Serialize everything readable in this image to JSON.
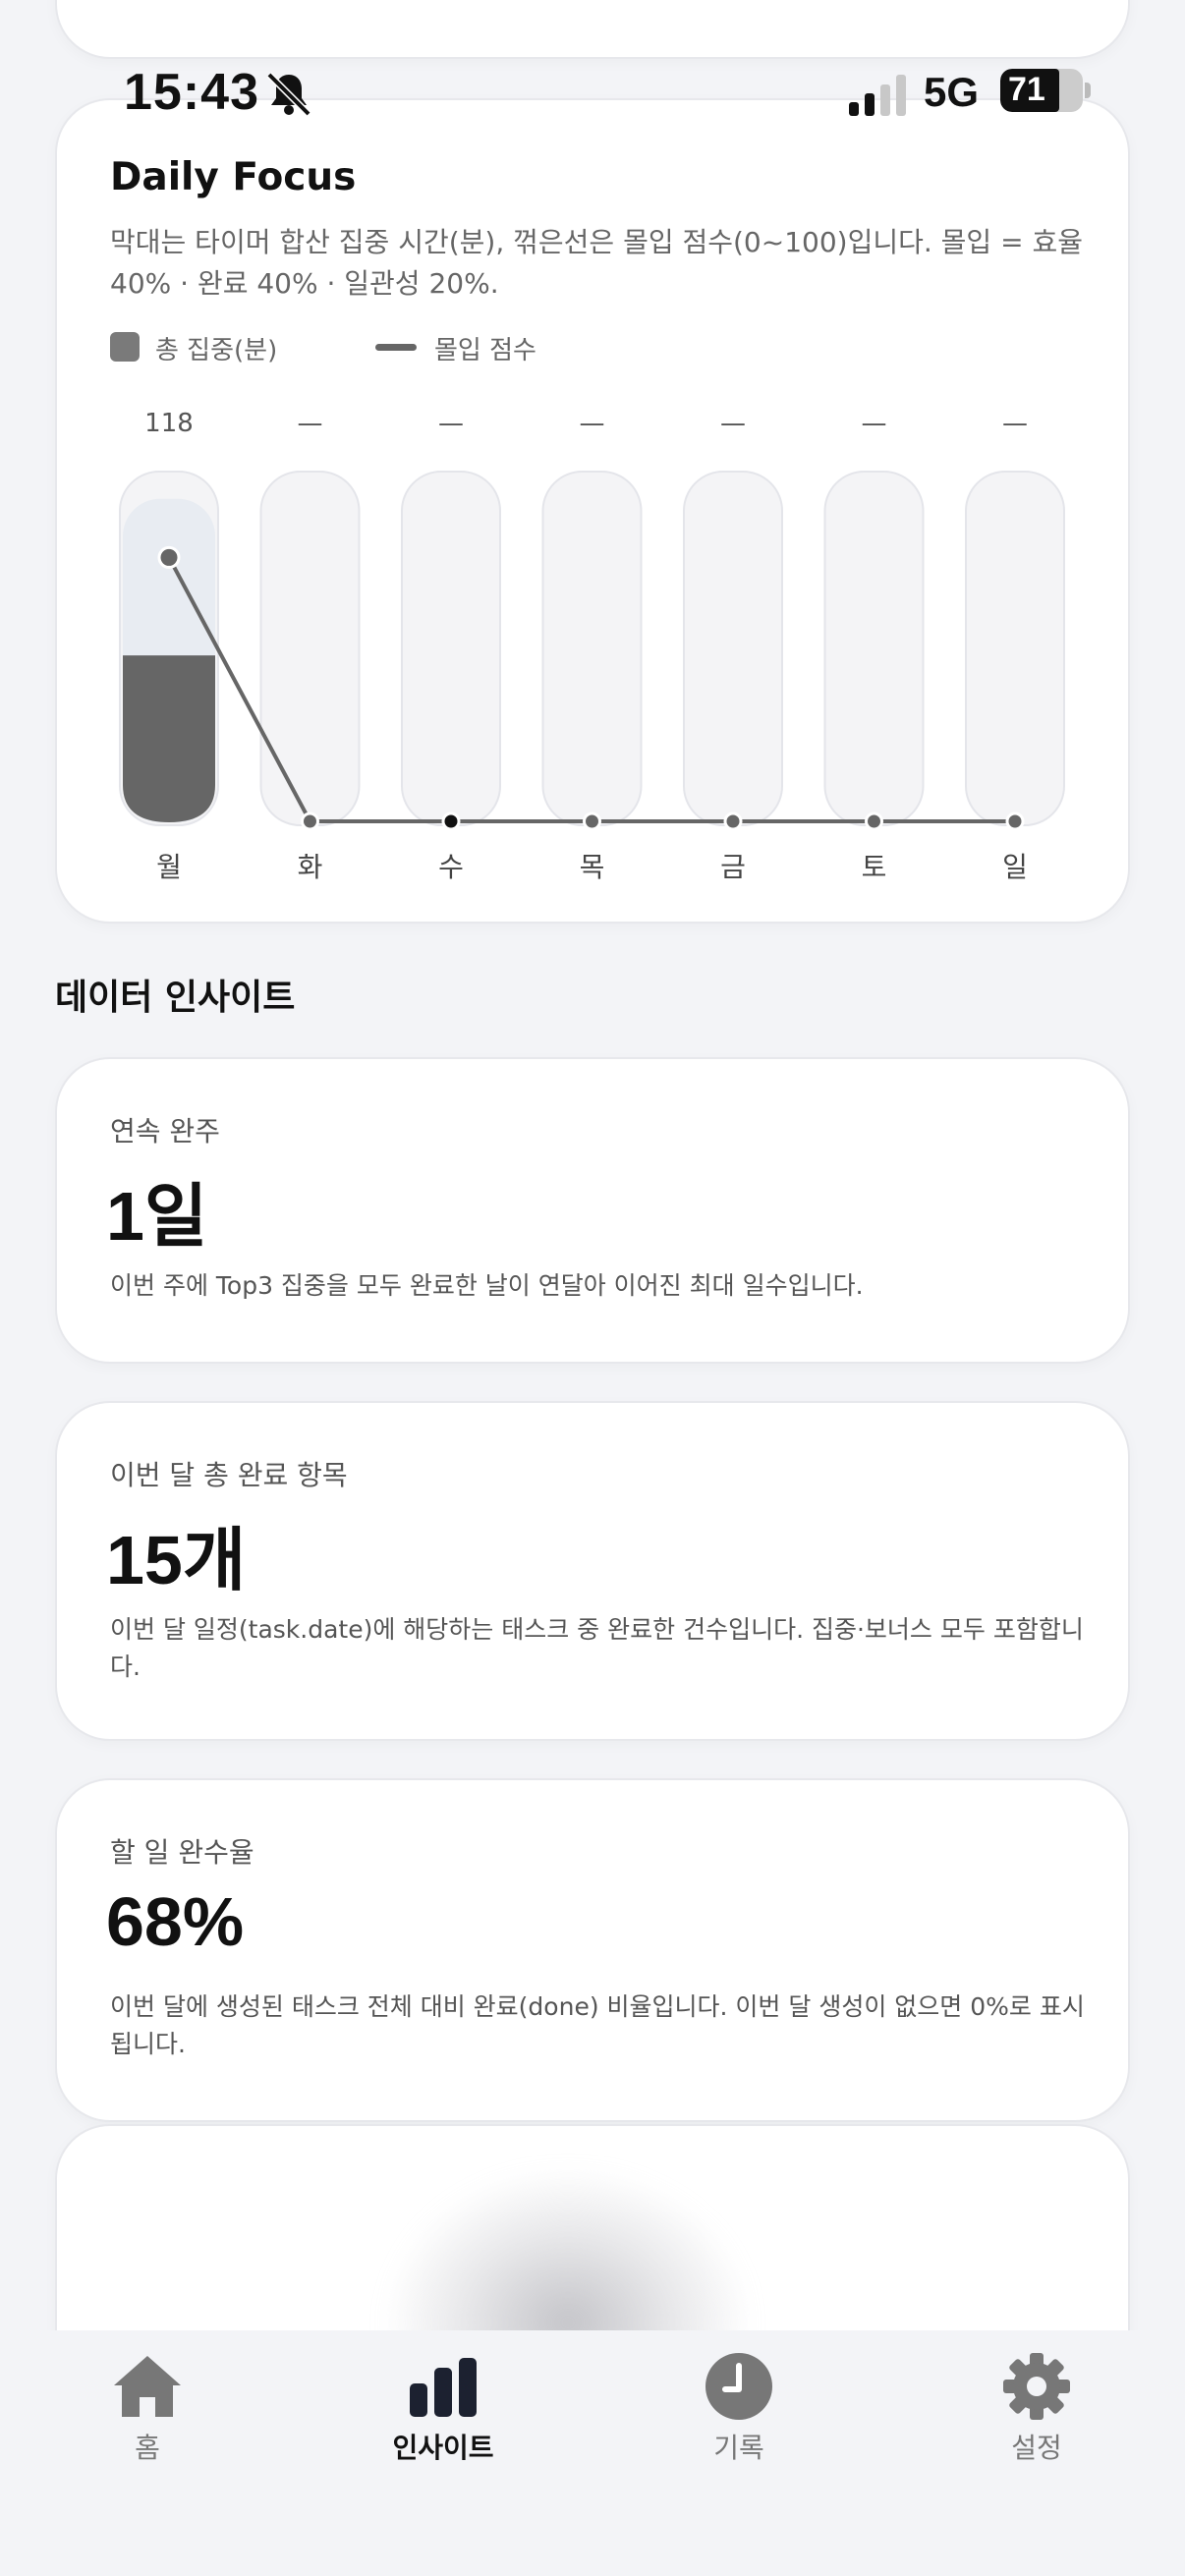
{
  "status_bar": {
    "time": "15:43",
    "network": "5G",
    "battery": "71",
    "battery_level": 0.71
  },
  "focus": {
    "title": "Daily Focus",
    "description": "막대는 타이머 합산 집중 시간(분), 꺾은선은 몰입 점수(0~100)입니다. 몰입 = 효율 40% · 완료 40% · 일관성 20%.",
    "legend_bar": "총 집중(분)",
    "legend_line": "몰입 점수"
  },
  "chart_data": {
    "type": "bar",
    "categories": [
      "월",
      "화",
      "수",
      "목",
      "금",
      "토",
      "일"
    ],
    "value_labels": [
      "118",
      "—",
      "—",
      "—",
      "—",
      "—",
      "—"
    ],
    "series": [
      {
        "name": "총 집중(분)",
        "values": [
          118,
          0,
          0,
          0,
          0,
          0,
          0
        ]
      },
      {
        "name": "몰입 점수",
        "values": [
          92,
          0,
          0,
          0,
          0,
          0,
          0
        ]
      }
    ],
    "focus_capacity_fraction": [
      0.93,
      0,
      0,
      0,
      0,
      0,
      0
    ],
    "bar_fill_fraction": [
      0.48,
      0,
      0,
      0,
      0,
      0,
      0
    ],
    "line_ylim": [
      0,
      100
    ],
    "today_index": 2,
    "colors": {
      "bar": "#666666",
      "bar_cap": "#e8ecf2",
      "track": "#f4f4f6",
      "line": "#666666",
      "today_dot": "#111111"
    }
  },
  "insights": {
    "section_title": "데이터 인사이트",
    "streak": {
      "label": "연속 완주",
      "value": "1일",
      "desc": "이번 주에 Top3 집중을 모두 완료한 날이 연달아 이어진 최대 일수입니다."
    },
    "monthly_done": {
      "label": "이번 달 총 완료 항목",
      "value": "15개",
      "desc": "이번 달 일정(task.date)에 해당하는 태스크 중 완료한 건수입니다. 집중·보너스 모두 포함합니다."
    },
    "completion_rate": {
      "label": "할 일 완수율",
      "value": "68%",
      "desc": "이번 달에 생성된 태스크 전체 대비 완료(done) 비율입니다. 이번 달 생성이 없으면 0%로 표시됩니다."
    }
  },
  "tabbar": {
    "items": [
      {
        "label": "홈",
        "icon": "home-icon"
      },
      {
        "label": "인사이트",
        "icon": "bar-chart-icon",
        "active": true
      },
      {
        "label": "기록",
        "icon": "clock-icon"
      },
      {
        "label": "설정",
        "icon": "gear-icon"
      }
    ]
  }
}
